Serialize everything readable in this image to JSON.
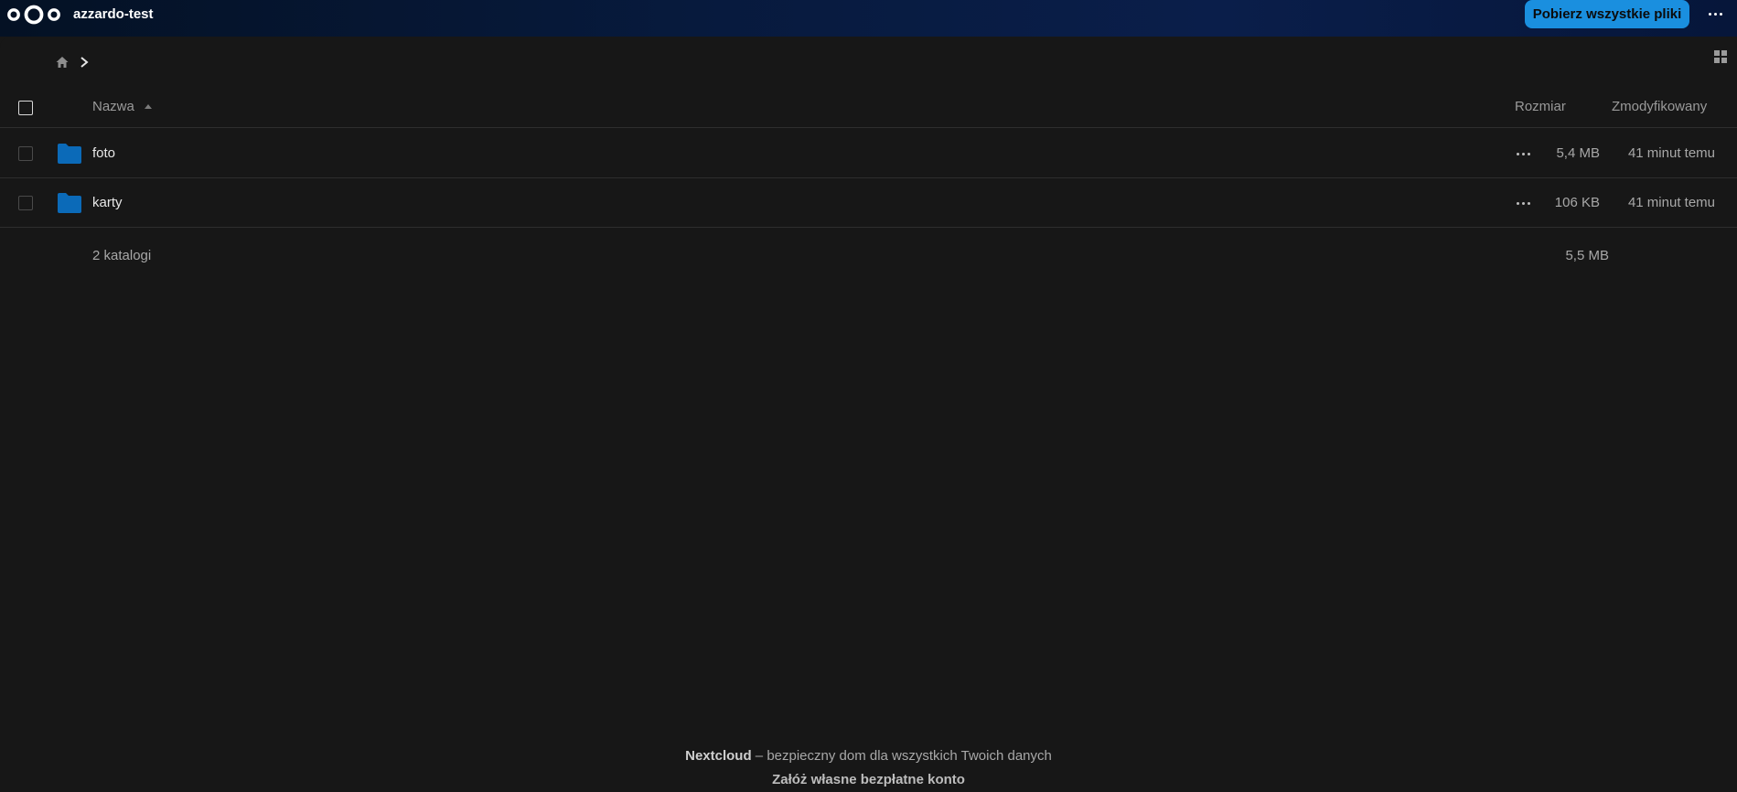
{
  "header": {
    "logo_icon": "nextcloud-logo-icon",
    "title": "azzardo-test",
    "download_all_label": "Pobierz wszystkie pliki",
    "menu_icon": "more-horizontal-icon"
  },
  "breadcrumb": {
    "home_icon": "home-icon",
    "separator_icon": "chevron-right-icon"
  },
  "view_toggle_icon": "grid-view-icon",
  "table": {
    "columns": {
      "name": "Nazwa",
      "size": "Rozmiar",
      "modified": "Zmodyfikowany"
    },
    "sort": {
      "column": "name",
      "direction": "ascending"
    },
    "rows": [
      {
        "name": "foto",
        "size": "5,4 MB",
        "modified": "41 minut temu",
        "icon": "folder-icon"
      },
      {
        "name": "karty",
        "size": "106 KB",
        "modified": "41 minut temu",
        "icon": "folder-icon"
      }
    ],
    "summary": {
      "label": "2 katalogi",
      "size": "5,5 MB"
    }
  },
  "footer": {
    "brand": "Nextcloud",
    "tagline": " – bezpieczny dom dla wszystkich Twoich danych",
    "signup_link": "Załóż własne bezpłatne konto"
  },
  "colors": {
    "accent": "#1a8fdf",
    "folder": "#0b6ab8",
    "background": "#171717"
  }
}
